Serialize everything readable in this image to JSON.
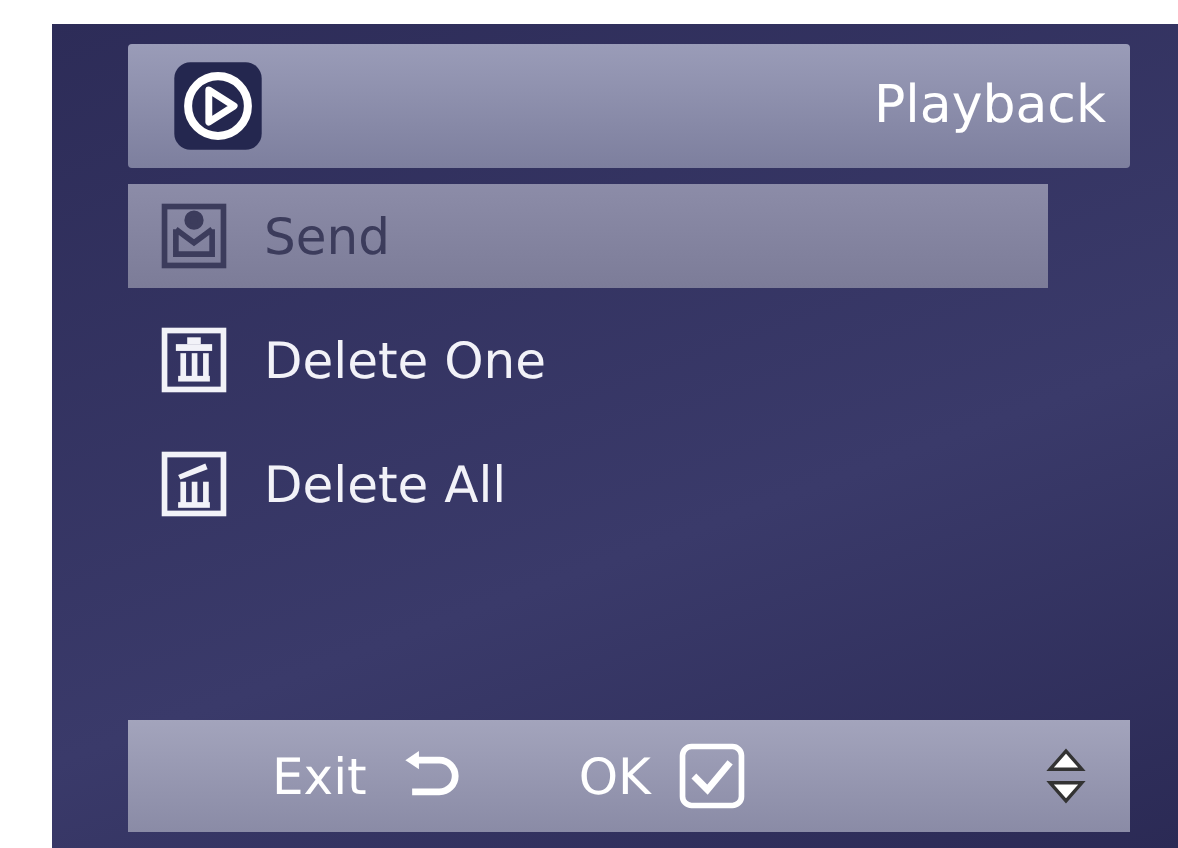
{
  "header": {
    "title": "Playback"
  },
  "menu": [
    {
      "label": "Send",
      "kind": "send",
      "selected": true
    },
    {
      "label": "Delete One",
      "kind": "trash",
      "selected": false
    },
    {
      "label": "Delete All",
      "kind": "trash-all",
      "selected": false
    }
  ],
  "footer": {
    "exit": "Exit",
    "ok": "OK"
  }
}
